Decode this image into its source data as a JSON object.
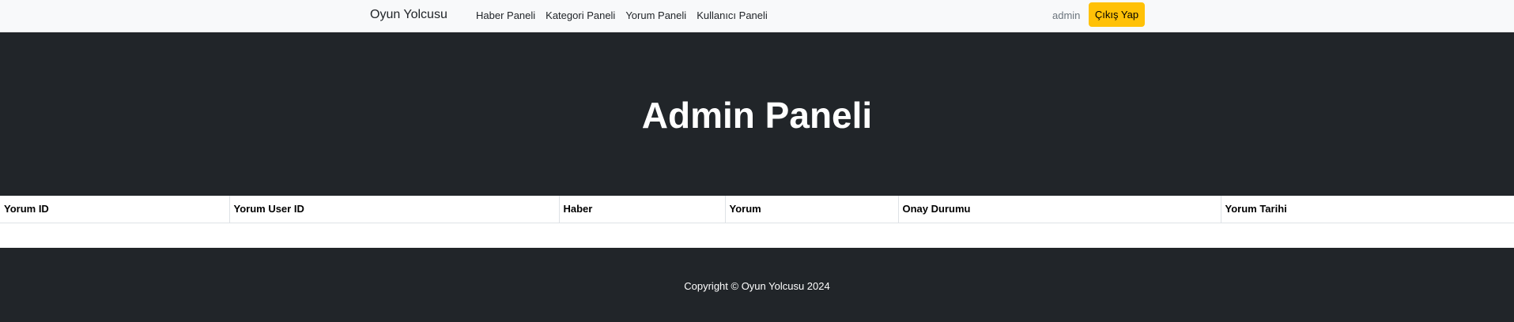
{
  "navbar": {
    "brand": "Oyun Yolcusu",
    "links": [
      "Haber Paneli",
      "Kategori Paneli",
      "Yorum Paneli",
      "Kullanıcı Paneli"
    ],
    "user": "admin",
    "logout_label": "Çıkış Yap",
    "logout_color": "#ffc107",
    "background": "#f8f9fa"
  },
  "hero": {
    "title": "Admin Paneli",
    "background": "#212529"
  },
  "table": {
    "headers": [
      "Yorum ID",
      "Yorum User ID",
      "Haber",
      "Yorum",
      "Onay Durumu",
      "Yorum Tarihi"
    ],
    "rows": []
  },
  "footer": {
    "text": "Copyright © Oyun Yolcusu 2024",
    "background": "#212529"
  }
}
